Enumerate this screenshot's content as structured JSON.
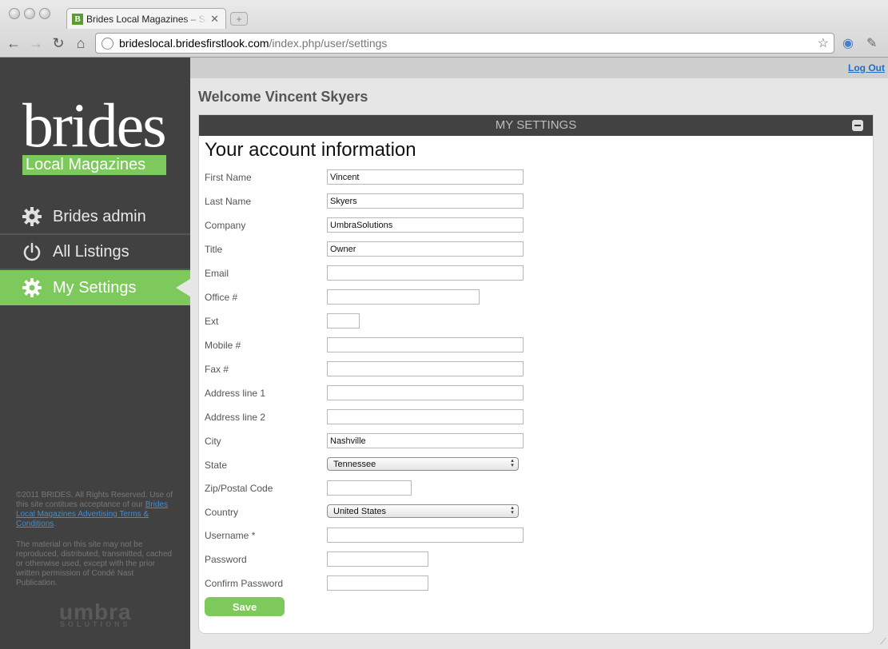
{
  "browser": {
    "tab_title": "Brides Local Magazines – Settings",
    "tab_favicon_letter": "B",
    "url_host": "brideslocal.bridesfirstlook.com",
    "url_path": "/index.php/user/settings"
  },
  "brand": {
    "word": "brides",
    "sub": "Local Magazines",
    "accent": "#7dc95b"
  },
  "sidebar": {
    "items": [
      {
        "label": "Brides admin",
        "icon": "gear-icon"
      },
      {
        "label": "All Listings",
        "icon": "power-icon"
      },
      {
        "label": "My Settings",
        "icon": "gear-icon",
        "active": true
      }
    ],
    "legal_prefix": "©2011 BRIDES. All Rights Reserved. Use of this site contitues acceptance of our",
    "legal_link": "Brides Local Magazines Advertising Terms & Conditions",
    "legal_suffix": ".",
    "legal_para2": "The material on this site may not be reproduced, distributed, transmitted, cached or otherwise used, except with the prior written permission of Condé Nast Publication.",
    "footer_logo": "umbra",
    "footer_logo_sub": "SOLUTIONS"
  },
  "header": {
    "logout": "Log Out",
    "welcome": "Welcome Vincent Skyers"
  },
  "panel": {
    "title": "MY SETTINGS",
    "form_title": "Your account information"
  },
  "form": {
    "fields": [
      {
        "label": "First Name",
        "value": "Vincent"
      },
      {
        "label": "Last Name",
        "value": "Skyers"
      },
      {
        "label": "Company",
        "value": "UmbraSolutions"
      },
      {
        "label": "Title",
        "value": "Owner"
      },
      {
        "label": "Email",
        "value": ""
      },
      {
        "label": "Office #",
        "value": ""
      },
      {
        "label": "Ext",
        "value": ""
      },
      {
        "label": "Mobile #",
        "value": ""
      },
      {
        "label": "Fax #",
        "value": ""
      },
      {
        "label": "Address line 1",
        "value": ""
      },
      {
        "label": "Address line 2",
        "value": ""
      },
      {
        "label": "City",
        "value": "Nashville"
      },
      {
        "label": "State",
        "value": "Tennessee"
      },
      {
        "label": "Zip/Postal Code",
        "value": ""
      },
      {
        "label": "Country",
        "value": "United States"
      },
      {
        "label": "Username *",
        "value": ""
      },
      {
        "label": "Password",
        "value": ""
      },
      {
        "label": "Confirm Password",
        "value": ""
      }
    ],
    "save_label": "Save"
  }
}
